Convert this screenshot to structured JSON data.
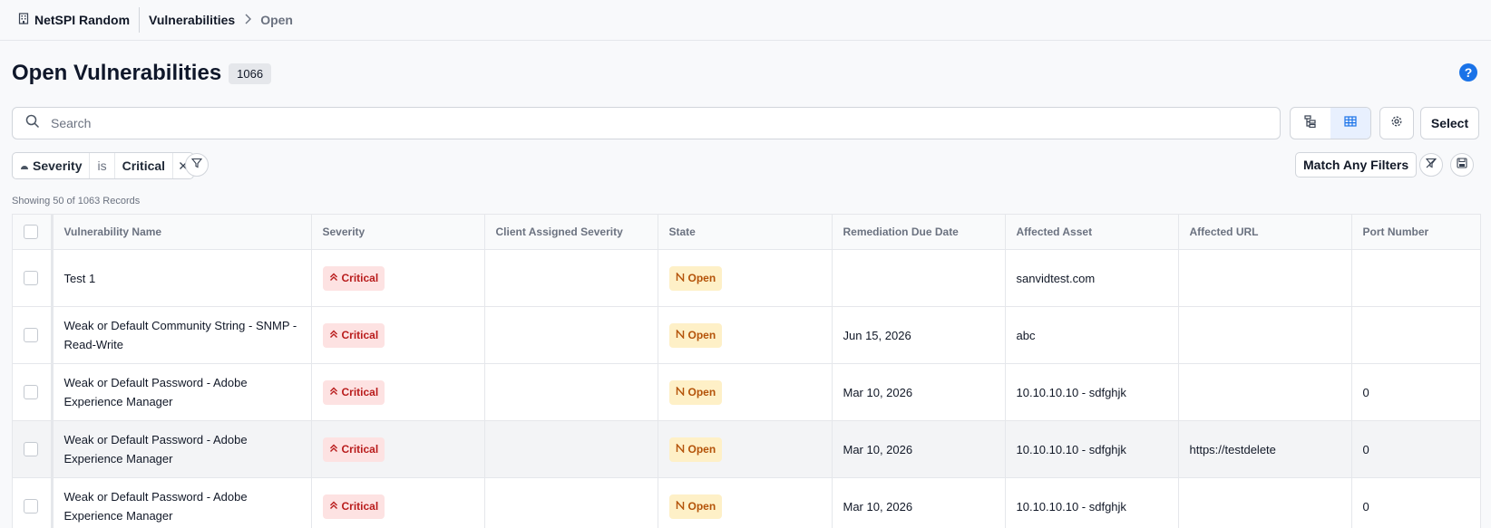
{
  "topbar": {
    "org_name": "NetSPI Random",
    "breadcrumb_section": "Vulnerabilities",
    "breadcrumb_current": "Open"
  },
  "header": {
    "title": "Open Vulnerabilities",
    "count": "1066",
    "help_label": "?"
  },
  "search": {
    "placeholder": "Search",
    "value": ""
  },
  "toolbar": {
    "select_label": "Select",
    "match_label": "Match Any Filters"
  },
  "filter": {
    "field": "Severity",
    "operator": "is",
    "value": "Critical"
  },
  "showing_text": "Showing 50 of 1063 Records",
  "table": {
    "columns": [
      "Vulnerability Name",
      "Severity",
      "Client Assigned Severity",
      "State",
      "Remediation Due Date",
      "Affected Asset",
      "Affected URL",
      "Port Number"
    ],
    "rows": [
      {
        "name": "Test 1",
        "severity": "Critical",
        "client_severity": "",
        "state": "Open",
        "due": "",
        "asset": "sanvidtest.com",
        "url": "",
        "port": ""
      },
      {
        "name": "Weak or Default Community String - SNMP - Read-Write",
        "severity": "Critical",
        "client_severity": "",
        "state": "Open",
        "due": "Jun 15, 2026",
        "asset": "abc",
        "url": "",
        "port": ""
      },
      {
        "name": "Weak or Default Password - Adobe Experience Manager",
        "severity": "Critical",
        "client_severity": "",
        "state": "Open",
        "due": "Mar 10, 2026",
        "asset": "10.10.10.10 - sdfghjk",
        "url": "",
        "port": "0"
      },
      {
        "name": "Weak or Default Password - Adobe Experience Manager",
        "severity": "Critical",
        "client_severity": "",
        "state": "Open",
        "due": "Mar 10, 2026",
        "asset": "10.10.10.10 - sdfghjk",
        "url": "https://testdelete",
        "port": "0"
      },
      {
        "name": "Weak or Default Password - Adobe Experience Manager",
        "severity": "Critical",
        "client_severity": "",
        "state": "Open",
        "due": "Mar 10, 2026",
        "asset": "10.10.10.10 - sdfghjk",
        "url": "",
        "port": "0"
      }
    ]
  },
  "colors": {
    "accent": "#1a73e8",
    "critical_bg": "#fde2e2",
    "critical_fg": "#b91c1c",
    "open_bg": "#fef0c7",
    "open_fg": "#b45309"
  }
}
